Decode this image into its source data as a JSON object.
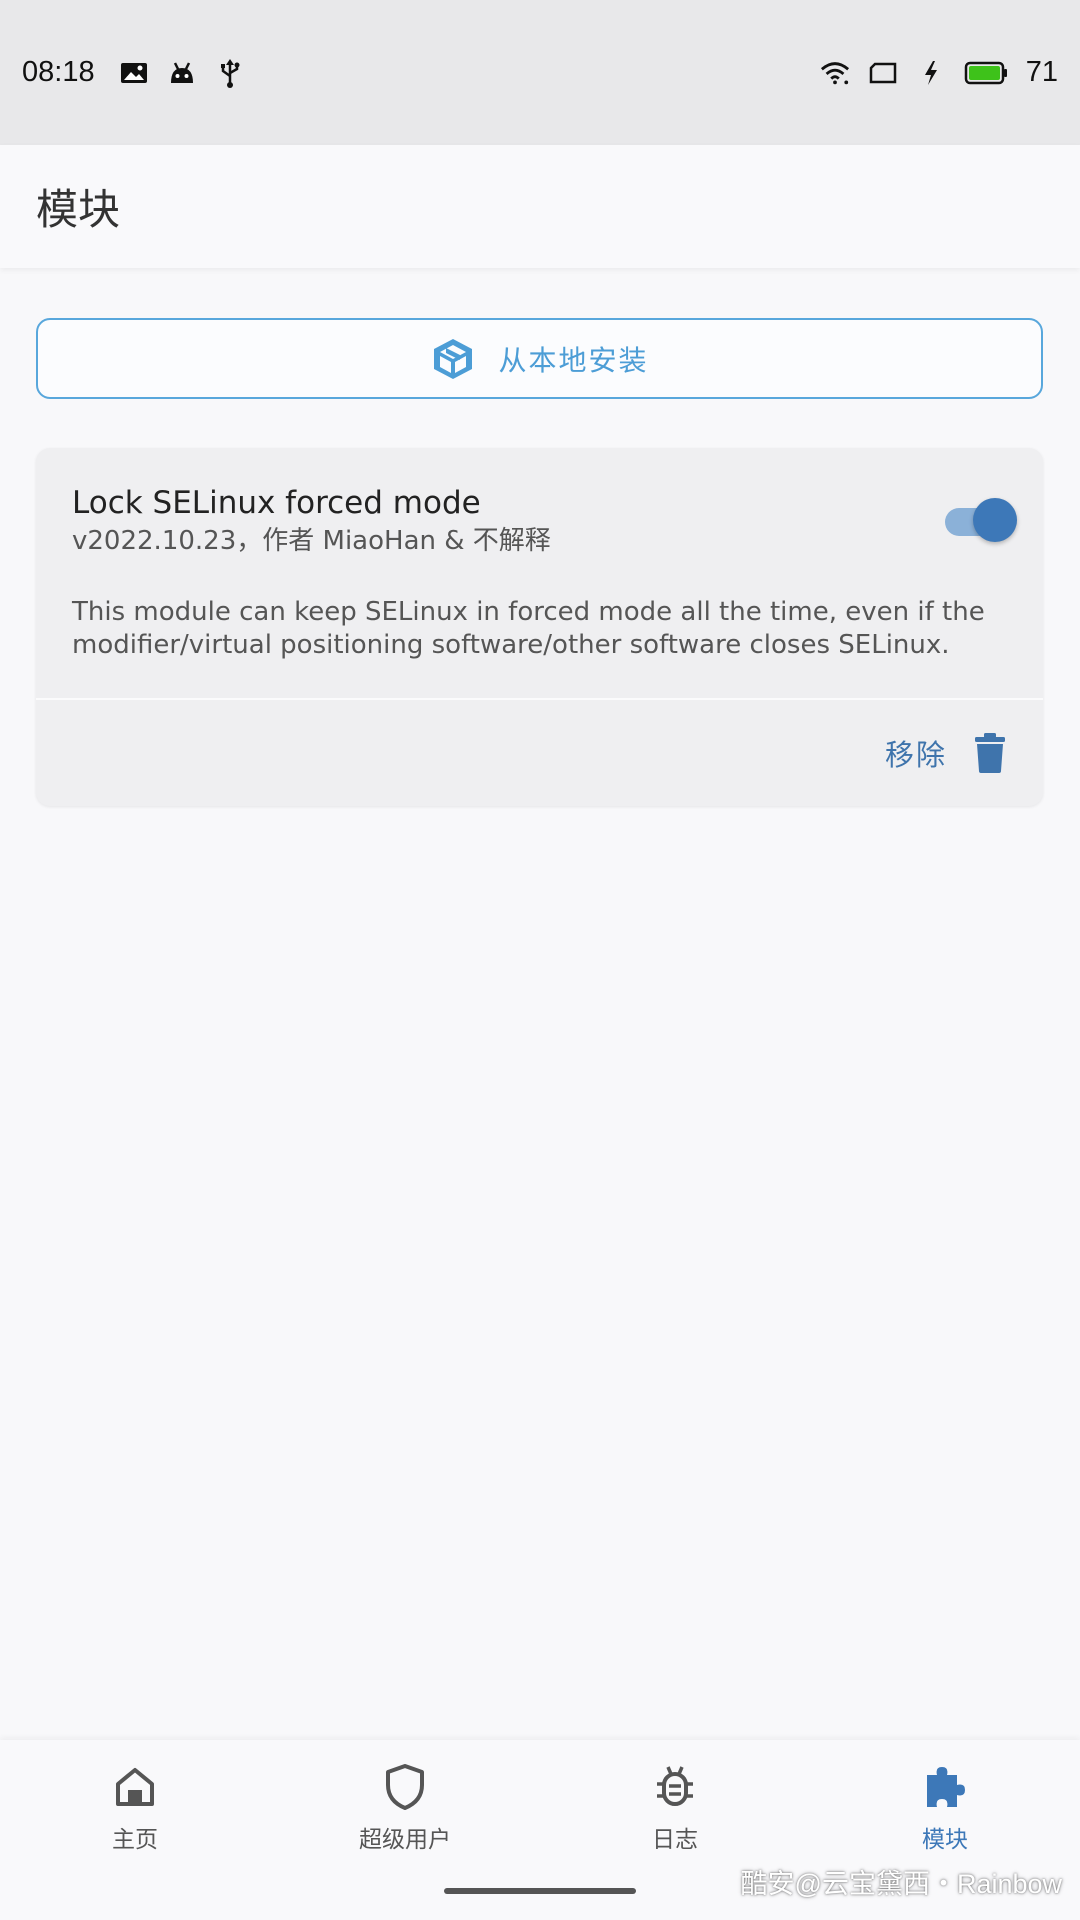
{
  "status_bar": {
    "time": "08:18",
    "left_icons": [
      "gallery-icon",
      "android-icon",
      "usb-icon"
    ],
    "right_icons": [
      "wifi-icon",
      "screen-icon",
      "charging-icon",
      "battery-icon"
    ],
    "battery_level": "71",
    "battery_color": "#3ec21a"
  },
  "app_bar": {
    "title": "模块"
  },
  "install_button": {
    "label": "从本地安装",
    "icon": "package-icon",
    "accent": "#4c9dd6"
  },
  "modules": [
    {
      "name": "Lock SELinux forced mode",
      "meta": "v2022.10.23，作者 MiaoHan & 不解释",
      "description": "This module can keep SELinux in forced mode all the time, even if the modifier/virtual positioning software/other software closes SELinux.",
      "enabled": true,
      "remove_label": "移除",
      "remove_icon": "trash-icon"
    }
  ],
  "bottom_nav": {
    "items": [
      {
        "label": "主页",
        "icon": "home-icon",
        "active": false
      },
      {
        "label": "超级用户",
        "icon": "shield-icon",
        "active": false
      },
      {
        "label": "日志",
        "icon": "bug-icon",
        "active": false
      },
      {
        "label": "模块",
        "icon": "puzzle-icon",
        "active": true
      }
    ],
    "active_color": "#3d78b8"
  },
  "watermark": "酷安@云宝黛西・Rainbow"
}
